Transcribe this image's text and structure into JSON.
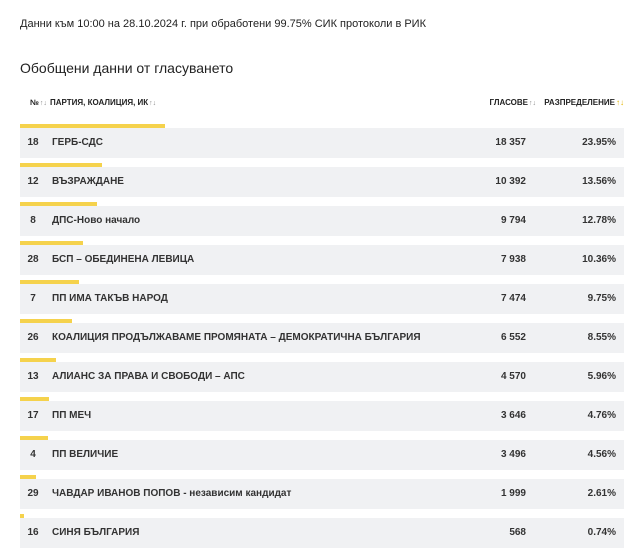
{
  "header": {
    "meta": "Данни към 10:00 на 28.10.2024 г. при обработени 99.75% СИК протоколи в РИК",
    "title": "Обобщени данни от гласуването"
  },
  "table": {
    "columns": {
      "num": "№",
      "party": "ПАРТИЯ, КОАЛИЦИЯ, ИК",
      "votes": "ГЛАСОВЕ",
      "distribution": "РАЗПРЕДЕЛЕНИЕ"
    },
    "sort_icon": "↑↓",
    "rows": [
      {
        "num": "18",
        "name": "ГЕРБ-СДС",
        "votes": "18 357",
        "pct": "23.95%",
        "share": 23.95
      },
      {
        "num": "12",
        "name": "ВЪЗРАЖДАНЕ",
        "votes": "10 392",
        "pct": "13.56%",
        "share": 13.56
      },
      {
        "num": "8",
        "name": "ДПС-Ново начало",
        "votes": "9 794",
        "pct": "12.78%",
        "share": 12.78
      },
      {
        "num": "28",
        "name": "БСП – ОБЕДИНЕНА ЛЕВИЦА",
        "votes": "7 938",
        "pct": "10.36%",
        "share": 10.36
      },
      {
        "num": "7",
        "name": "ПП ИМА ТАКЪВ НАРОД",
        "votes": "7 474",
        "pct": "9.75%",
        "share": 9.75
      },
      {
        "num": "26",
        "name": "КОАЛИЦИЯ ПРОДЪЛЖАВАМЕ ПРОМЯНАТА – ДЕМОКРАТИЧНА БЪЛГАРИЯ",
        "votes": "6 552",
        "pct": "8.55%",
        "share": 8.55
      },
      {
        "num": "13",
        "name": "АЛИАНС ЗА ПРАВА И СВОБОДИ – АПС",
        "votes": "4 570",
        "pct": "5.96%",
        "share": 5.96
      },
      {
        "num": "17",
        "name": "ПП МЕЧ",
        "votes": "3 646",
        "pct": "4.76%",
        "share": 4.76
      },
      {
        "num": "4",
        "name": "ПП ВЕЛИЧИЕ",
        "votes": "3 496",
        "pct": "4.56%",
        "share": 4.56
      },
      {
        "num": "29",
        "name": "ЧАВДАР ИВАНОВ ПОПОВ - независим кандидат",
        "votes": "1 999",
        "pct": "2.61%",
        "share": 2.61
      },
      {
        "num": "16",
        "name": "СИНЯ БЪЛГАРИЯ",
        "votes": "568",
        "pct": "0.74%",
        "share": 0.74
      }
    ]
  },
  "colors": {
    "bar": "#f5d24c",
    "row_bg": "#f0f1f3",
    "active_sort": "#e3b400"
  }
}
